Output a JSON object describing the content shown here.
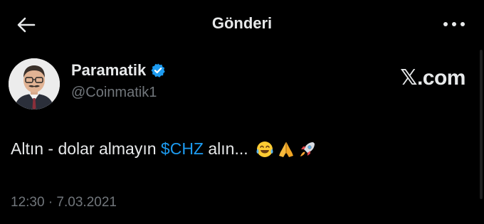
{
  "header": {
    "title": "Gönderi",
    "back_icon": "arrow-left-icon",
    "more_icon": "more-horizontal-icon"
  },
  "tweet": {
    "author_name": "Paramatik",
    "verified_icon": "verified-badge-icon",
    "handle": "@Coinmatik1",
    "source": "𝕏.com",
    "text_before": "Altın - dolar almayın ",
    "cashtag": "$CHZ",
    "text_after": " alın...",
    "emojis": [
      "face-with-tears-of-joy-icon",
      "folded-hands-icon",
      "rocket-icon"
    ],
    "timestamp": "12:30 · 7.03.2021"
  },
  "colors": {
    "background": "#000000",
    "text_primary": "#e7e9ea",
    "text_secondary": "#71767b",
    "accent": "#1d9bf0"
  }
}
